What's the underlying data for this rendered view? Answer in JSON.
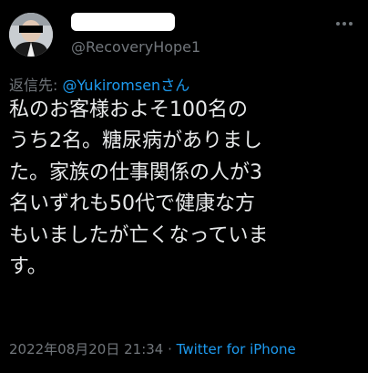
{
  "author": {
    "avatar_icon": "user-avatar-icon",
    "display_name": "",
    "handle": "@RecoveryHope1"
  },
  "more_icon": "more-options-icon",
  "reply": {
    "prefix": "返信先: ",
    "to": "@Yukiromsenさん"
  },
  "tweet": {
    "lines": [
      "私のお客様およそ100名の",
      "うち2名。糖尿病がありまし",
      "た。家族の仕事関係の人が3",
      "名いずれも50代で健康な方",
      "もいましたが亡くなっていま",
      "す。"
    ]
  },
  "meta": {
    "timestamp": "2022年08月20日 21:34",
    "separator": " · ",
    "source": "Twitter for iPhone"
  },
  "colors": {
    "background": "#000000",
    "text": "#e7e9ea",
    "muted": "#71767b",
    "link": "#1d9bf0"
  }
}
